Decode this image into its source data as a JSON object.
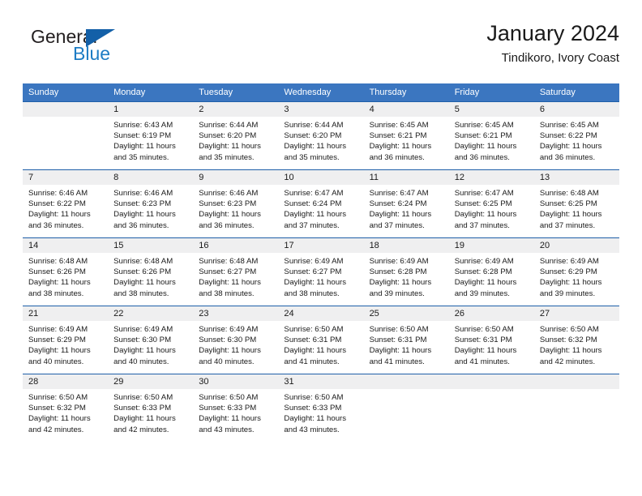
{
  "brand": {
    "name_top": "General",
    "name_bottom": "Blue",
    "triangle_color": "#1360a8",
    "blue_color": "#1d7cc4"
  },
  "header": {
    "title": "January 2024",
    "subtitle": "Tindikoro, Ivory Coast",
    "accent_color": "#3b76c0",
    "cell_border_color": "#1e5fa8",
    "daynum_bg": "#efeff0"
  },
  "labels": {
    "sunrise_prefix": "Sunrise:",
    "sunset_prefix": "Sunset:",
    "daylight_prefix": "Daylight:"
  },
  "weekdays": [
    "Sunday",
    "Monday",
    "Tuesday",
    "Wednesday",
    "Thursday",
    "Friday",
    "Saturday"
  ],
  "weeks": [
    [
      {
        "day": "",
        "blank": true,
        "sunrise": "",
        "sunset": "",
        "daylight_1": "",
        "daylight_2": ""
      },
      {
        "day": "1",
        "sunrise": "Sunrise: 6:43 AM",
        "sunset": "Sunset: 6:19 PM",
        "daylight_1": "Daylight: 11 hours",
        "daylight_2": "and 35 minutes."
      },
      {
        "day": "2",
        "sunrise": "Sunrise: 6:44 AM",
        "sunset": "Sunset: 6:20 PM",
        "daylight_1": "Daylight: 11 hours",
        "daylight_2": "and 35 minutes."
      },
      {
        "day": "3",
        "sunrise": "Sunrise: 6:44 AM",
        "sunset": "Sunset: 6:20 PM",
        "daylight_1": "Daylight: 11 hours",
        "daylight_2": "and 35 minutes."
      },
      {
        "day": "4",
        "sunrise": "Sunrise: 6:45 AM",
        "sunset": "Sunset: 6:21 PM",
        "daylight_1": "Daylight: 11 hours",
        "daylight_2": "and 36 minutes."
      },
      {
        "day": "5",
        "sunrise": "Sunrise: 6:45 AM",
        "sunset": "Sunset: 6:21 PM",
        "daylight_1": "Daylight: 11 hours",
        "daylight_2": "and 36 minutes."
      },
      {
        "day": "6",
        "sunrise": "Sunrise: 6:45 AM",
        "sunset": "Sunset: 6:22 PM",
        "daylight_1": "Daylight: 11 hours",
        "daylight_2": "and 36 minutes."
      }
    ],
    [
      {
        "day": "7",
        "sunrise": "Sunrise: 6:46 AM",
        "sunset": "Sunset: 6:22 PM",
        "daylight_1": "Daylight: 11 hours",
        "daylight_2": "and 36 minutes."
      },
      {
        "day": "8",
        "sunrise": "Sunrise: 6:46 AM",
        "sunset": "Sunset: 6:23 PM",
        "daylight_1": "Daylight: 11 hours",
        "daylight_2": "and 36 minutes."
      },
      {
        "day": "9",
        "sunrise": "Sunrise: 6:46 AM",
        "sunset": "Sunset: 6:23 PM",
        "daylight_1": "Daylight: 11 hours",
        "daylight_2": "and 36 minutes."
      },
      {
        "day": "10",
        "sunrise": "Sunrise: 6:47 AM",
        "sunset": "Sunset: 6:24 PM",
        "daylight_1": "Daylight: 11 hours",
        "daylight_2": "and 37 minutes."
      },
      {
        "day": "11",
        "sunrise": "Sunrise: 6:47 AM",
        "sunset": "Sunset: 6:24 PM",
        "daylight_1": "Daylight: 11 hours",
        "daylight_2": "and 37 minutes."
      },
      {
        "day": "12",
        "sunrise": "Sunrise: 6:47 AM",
        "sunset": "Sunset: 6:25 PM",
        "daylight_1": "Daylight: 11 hours",
        "daylight_2": "and 37 minutes."
      },
      {
        "day": "13",
        "sunrise": "Sunrise: 6:48 AM",
        "sunset": "Sunset: 6:25 PM",
        "daylight_1": "Daylight: 11 hours",
        "daylight_2": "and 37 minutes."
      }
    ],
    [
      {
        "day": "14",
        "sunrise": "Sunrise: 6:48 AM",
        "sunset": "Sunset: 6:26 PM",
        "daylight_1": "Daylight: 11 hours",
        "daylight_2": "and 38 minutes."
      },
      {
        "day": "15",
        "sunrise": "Sunrise: 6:48 AM",
        "sunset": "Sunset: 6:26 PM",
        "daylight_1": "Daylight: 11 hours",
        "daylight_2": "and 38 minutes."
      },
      {
        "day": "16",
        "sunrise": "Sunrise: 6:48 AM",
        "sunset": "Sunset: 6:27 PM",
        "daylight_1": "Daylight: 11 hours",
        "daylight_2": "and 38 minutes."
      },
      {
        "day": "17",
        "sunrise": "Sunrise: 6:49 AM",
        "sunset": "Sunset: 6:27 PM",
        "daylight_1": "Daylight: 11 hours",
        "daylight_2": "and 38 minutes."
      },
      {
        "day": "18",
        "sunrise": "Sunrise: 6:49 AM",
        "sunset": "Sunset: 6:28 PM",
        "daylight_1": "Daylight: 11 hours",
        "daylight_2": "and 39 minutes."
      },
      {
        "day": "19",
        "sunrise": "Sunrise: 6:49 AM",
        "sunset": "Sunset: 6:28 PM",
        "daylight_1": "Daylight: 11 hours",
        "daylight_2": "and 39 minutes."
      },
      {
        "day": "20",
        "sunrise": "Sunrise: 6:49 AM",
        "sunset": "Sunset: 6:29 PM",
        "daylight_1": "Daylight: 11 hours",
        "daylight_2": "and 39 minutes."
      }
    ],
    [
      {
        "day": "21",
        "sunrise": "Sunrise: 6:49 AM",
        "sunset": "Sunset: 6:29 PM",
        "daylight_1": "Daylight: 11 hours",
        "daylight_2": "and 40 minutes."
      },
      {
        "day": "22",
        "sunrise": "Sunrise: 6:49 AM",
        "sunset": "Sunset: 6:30 PM",
        "daylight_1": "Daylight: 11 hours",
        "daylight_2": "and 40 minutes."
      },
      {
        "day": "23",
        "sunrise": "Sunrise: 6:49 AM",
        "sunset": "Sunset: 6:30 PM",
        "daylight_1": "Daylight: 11 hours",
        "daylight_2": "and 40 minutes."
      },
      {
        "day": "24",
        "sunrise": "Sunrise: 6:50 AM",
        "sunset": "Sunset: 6:31 PM",
        "daylight_1": "Daylight: 11 hours",
        "daylight_2": "and 41 minutes."
      },
      {
        "day": "25",
        "sunrise": "Sunrise: 6:50 AM",
        "sunset": "Sunset: 6:31 PM",
        "daylight_1": "Daylight: 11 hours",
        "daylight_2": "and 41 minutes."
      },
      {
        "day": "26",
        "sunrise": "Sunrise: 6:50 AM",
        "sunset": "Sunset: 6:31 PM",
        "daylight_1": "Daylight: 11 hours",
        "daylight_2": "and 41 minutes."
      },
      {
        "day": "27",
        "sunrise": "Sunrise: 6:50 AM",
        "sunset": "Sunset: 6:32 PM",
        "daylight_1": "Daylight: 11 hours",
        "daylight_2": "and 42 minutes."
      }
    ],
    [
      {
        "day": "28",
        "sunrise": "Sunrise: 6:50 AM",
        "sunset": "Sunset: 6:32 PM",
        "daylight_1": "Daylight: 11 hours",
        "daylight_2": "and 42 minutes."
      },
      {
        "day": "29",
        "sunrise": "Sunrise: 6:50 AM",
        "sunset": "Sunset: 6:33 PM",
        "daylight_1": "Daylight: 11 hours",
        "daylight_2": "and 42 minutes."
      },
      {
        "day": "30",
        "sunrise": "Sunrise: 6:50 AM",
        "sunset": "Sunset: 6:33 PM",
        "daylight_1": "Daylight: 11 hours",
        "daylight_2": "and 43 minutes."
      },
      {
        "day": "31",
        "sunrise": "Sunrise: 6:50 AM",
        "sunset": "Sunset: 6:33 PM",
        "daylight_1": "Daylight: 11 hours",
        "daylight_2": "and 43 minutes."
      },
      {
        "day": "",
        "blank": true,
        "sunrise": "",
        "sunset": "",
        "daylight_1": "",
        "daylight_2": ""
      },
      {
        "day": "",
        "blank": true,
        "sunrise": "",
        "sunset": "",
        "daylight_1": "",
        "daylight_2": ""
      },
      {
        "day": "",
        "blank": true,
        "sunrise": "",
        "sunset": "",
        "daylight_1": "",
        "daylight_2": ""
      }
    ]
  ]
}
